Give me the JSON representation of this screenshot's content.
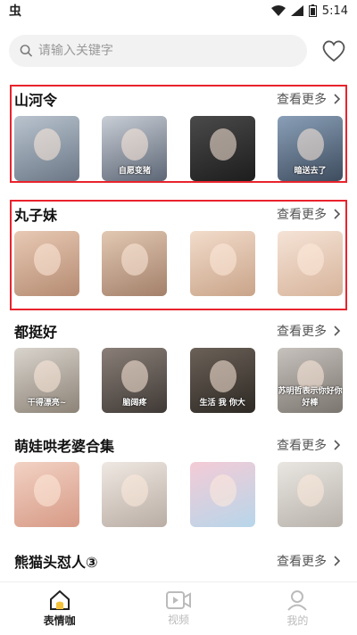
{
  "status": {
    "left_glyph": "虫",
    "time": "5:14"
  },
  "search": {
    "placeholder": "请输入关键字"
  },
  "sections": [
    {
      "title": "山河令",
      "more": "查看更多",
      "thumbs": [
        {
          "caption": "",
          "colors": [
            "#b9c4cf",
            "#6b7786"
          ]
        },
        {
          "caption": "自愿变猪",
          "colors": [
            "#c9ced6",
            "#5c6675"
          ]
        },
        {
          "caption": "",
          "colors": [
            "#4a4a4a",
            "#1d1d1d"
          ]
        },
        {
          "caption": "暗送去了",
          "colors": [
            "#8aa0b8",
            "#3e4c5e"
          ]
        }
      ]
    },
    {
      "title": "丸子妹",
      "more": "查看更多",
      "thumbs": [
        {
          "caption": "",
          "colors": [
            "#e8c9b4",
            "#b58b72"
          ]
        },
        {
          "caption": "",
          "colors": [
            "#e2c8b2",
            "#a3806a"
          ]
        },
        {
          "caption": "",
          "colors": [
            "#f2dccb",
            "#c9a489"
          ]
        },
        {
          "caption": "",
          "colors": [
            "#f5e3d6",
            "#d7b49b"
          ]
        }
      ]
    },
    {
      "title": "都挺好",
      "more": "查看更多",
      "thumbs": [
        {
          "caption": "干得漂亮~",
          "colors": [
            "#d9d4cd",
            "#8d8377"
          ]
        },
        {
          "caption": "脑阔疼",
          "colors": [
            "#8a7f78",
            "#3f3935"
          ]
        },
        {
          "caption": "生活 我 你大",
          "colors": [
            "#6b6158",
            "#2e2924"
          ]
        },
        {
          "caption": "苏明哲表示你好你好棒",
          "colors": [
            "#c7c2bd",
            "#7b756f"
          ]
        }
      ]
    },
    {
      "title": "萌娃哄老婆合集",
      "more": "查看更多",
      "thumbs": [
        {
          "caption": "",
          "colors": [
            "#f2d2c4",
            "#d79a86"
          ]
        },
        {
          "caption": "",
          "colors": [
            "#efe8e2",
            "#b9ada4"
          ]
        },
        {
          "caption": "",
          "colors": [
            "#f4cbd6",
            "#b7d6ea"
          ]
        },
        {
          "caption": "",
          "colors": [
            "#e9e6e1",
            "#b8b2ab"
          ]
        }
      ]
    },
    {
      "title": "熊猫头怼人③",
      "more": "查看更多",
      "thumbs": []
    }
  ],
  "tabs": [
    {
      "label": "表情咖",
      "icon": "home-icon",
      "active": true
    },
    {
      "label": "视频",
      "icon": "video-icon",
      "active": false
    },
    {
      "label": "我的",
      "icon": "user-icon",
      "active": false
    }
  ],
  "colors": {
    "highlight": "#e8232d",
    "accent": "#f5c33b"
  }
}
